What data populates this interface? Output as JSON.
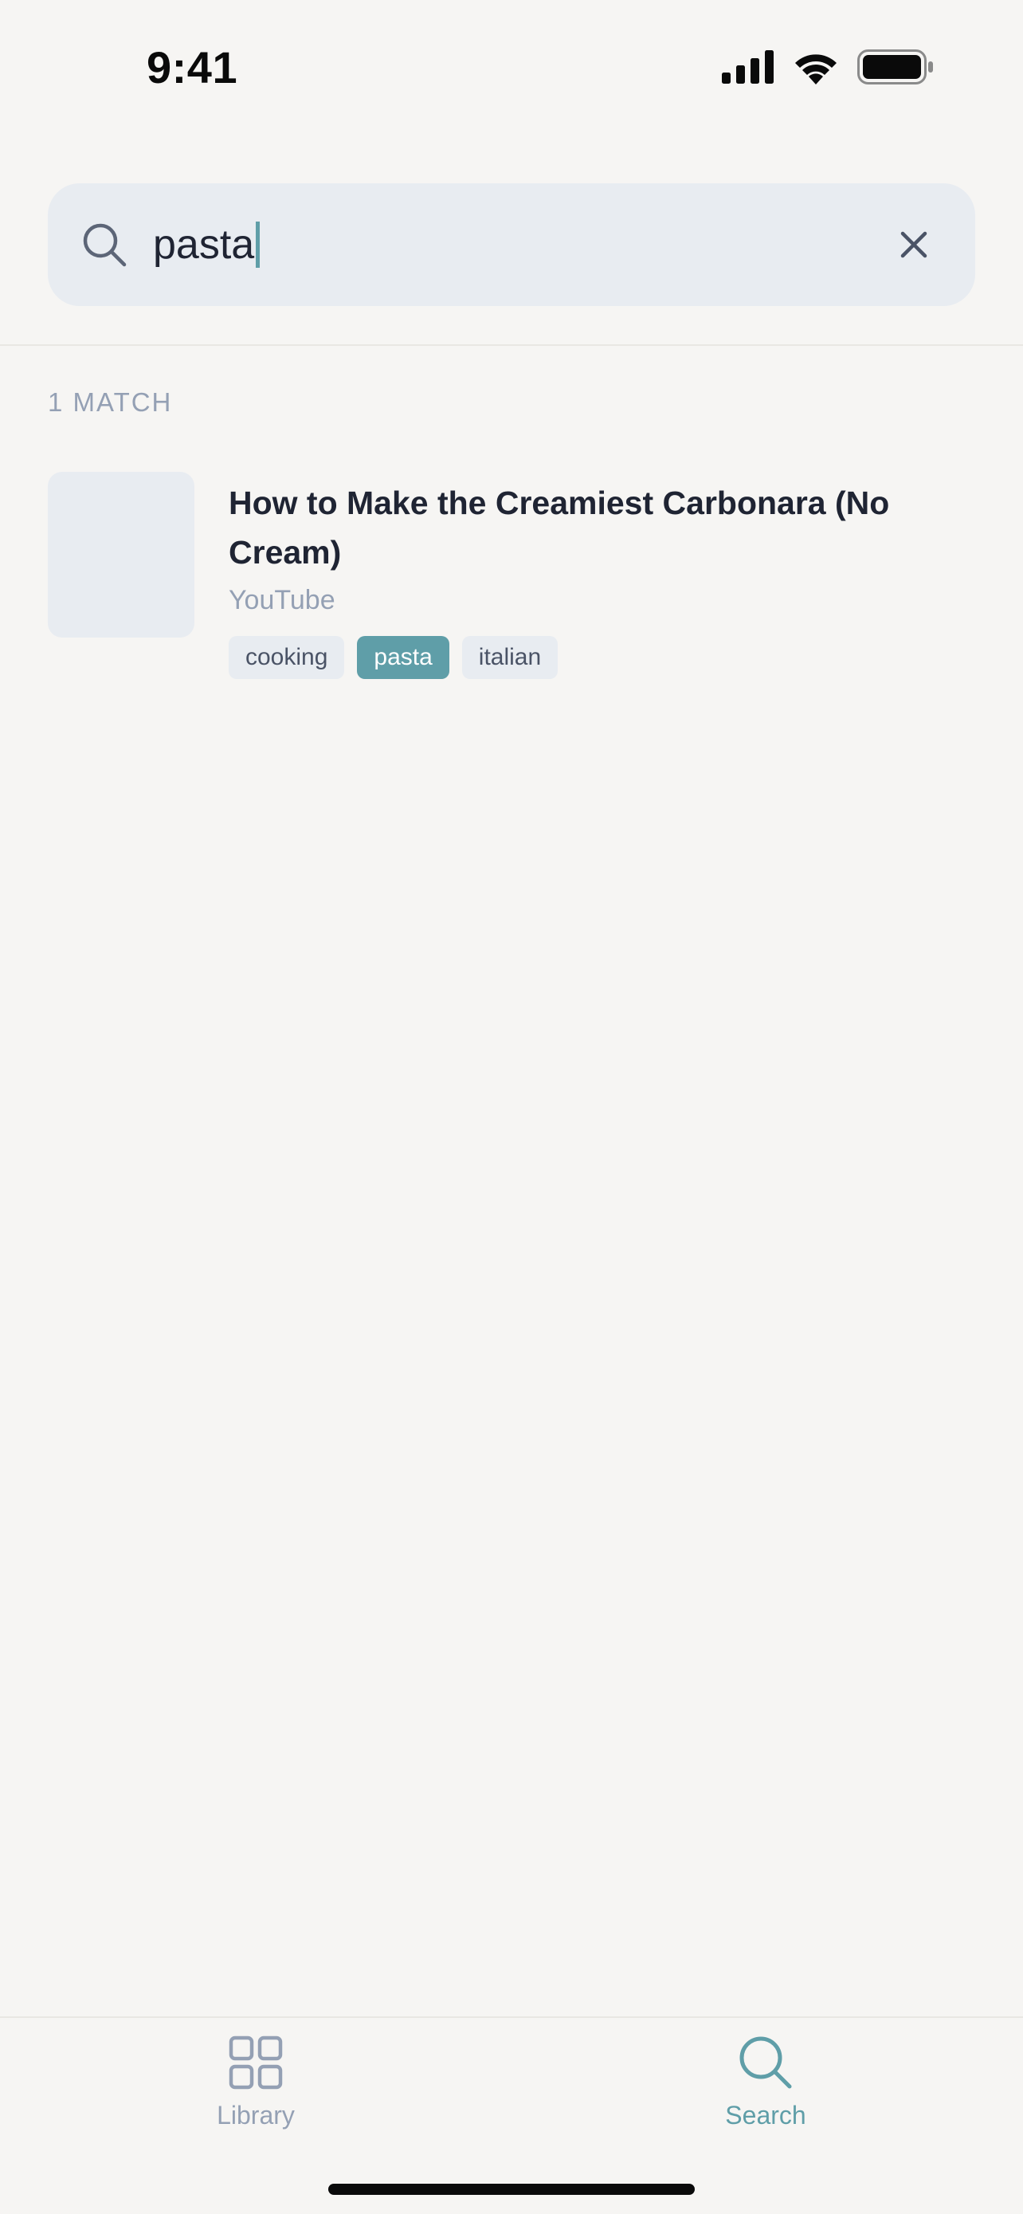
{
  "status_bar": {
    "time": "9:41",
    "icons": [
      "signal-icon",
      "wifi-icon",
      "battery-icon"
    ]
  },
  "search": {
    "query": "pasta",
    "icon": "search-icon",
    "clear_icon": "close-icon"
  },
  "results": {
    "count_label": "1 MATCH",
    "items": [
      {
        "title": "How to Make the Creamiest Carbonara (No Cream)",
        "source": "YouTube",
        "tags": [
          {
            "label": "cooking",
            "active": false
          },
          {
            "label": "pasta",
            "active": true
          },
          {
            "label": "italian",
            "active": false
          }
        ]
      }
    ]
  },
  "tab_bar": {
    "tabs": [
      {
        "label": "Library",
        "icon": "grid-icon",
        "selected": false
      },
      {
        "label": "Search",
        "icon": "search-icon",
        "selected": true
      }
    ]
  },
  "colors": {
    "accent": "#5f9ea8",
    "background": "#f6f5f3",
    "surface": "#e8ecf1",
    "muted_text": "#94a0b4",
    "primary_text": "#1f2433"
  }
}
